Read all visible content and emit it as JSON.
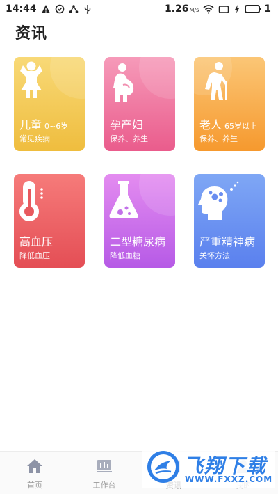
{
  "status_bar": {
    "time": "14:44",
    "speed": "1.26",
    "speed_unit": "M/s",
    "sim_number": "1"
  },
  "page": {
    "title": "资讯"
  },
  "cards": [
    {
      "title": "儿童",
      "subtitle": "0~6岁",
      "desc": "常见疾病",
      "icon": "child-icon",
      "color": "#efbd3e"
    },
    {
      "title": "孕产妇",
      "subtitle": "",
      "desc": "保养、养生",
      "icon": "pregnant-woman-icon",
      "color": "#ea5c8c"
    },
    {
      "title": "老人",
      "subtitle": "65岁以上",
      "desc": "保养、养生",
      "icon": "elderly-icon",
      "color": "#f6992e"
    },
    {
      "title": "高血压",
      "subtitle": "",
      "desc": "降低血压",
      "icon": "thermometer-icon",
      "color": "#e44e55"
    },
    {
      "title": "二型糖尿病",
      "subtitle": "",
      "desc": "降低血糖",
      "icon": "flask-icon",
      "color": "#b65ae6"
    },
    {
      "title": "严重精神病",
      "subtitle": "",
      "desc": "关怀方法",
      "icon": "head-mind-icon",
      "color": "#5a80ee"
    }
  ],
  "nav": [
    {
      "label": "首页",
      "icon": "home-icon"
    },
    {
      "label": "工作台",
      "icon": "workbench-icon"
    },
    {
      "label": "资讯",
      "icon": "news-icon",
      "active": true
    },
    {
      "label": "我的",
      "icon": "profile-icon"
    }
  ],
  "watermark": {
    "brand": "飞翔下载",
    "url": "WWW.FXXZ.COM"
  }
}
